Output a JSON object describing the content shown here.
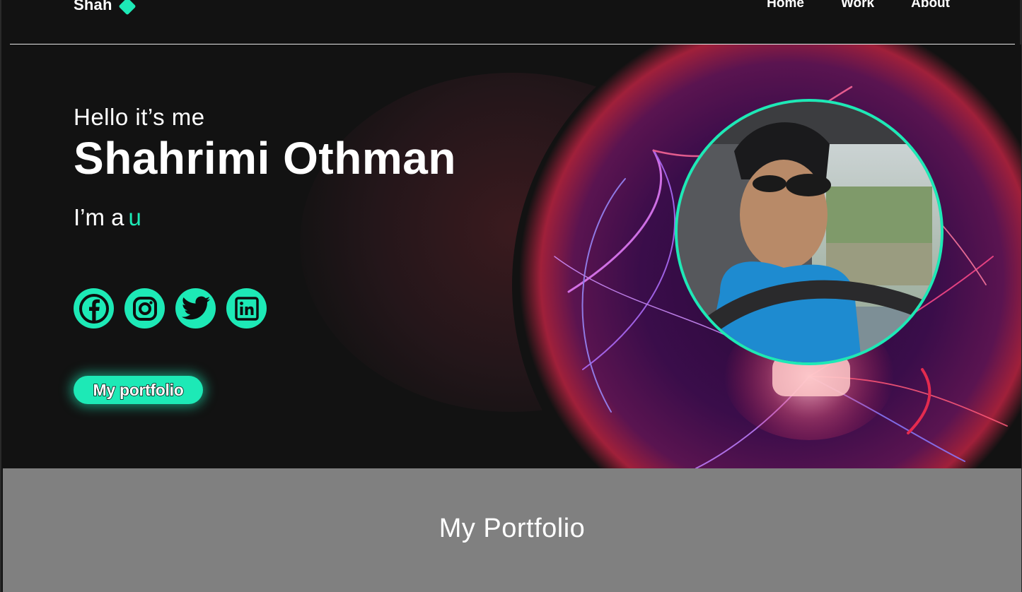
{
  "brand": {
    "name": "Shah",
    "accent_color": "#1de9b6"
  },
  "nav": {
    "links": [
      "Home",
      "Work",
      "About"
    ]
  },
  "hero": {
    "greeting": "Hello it’s me",
    "name": "Shahrimi Othman",
    "role_prefix": "I’m a",
    "role_typed": "u",
    "socials": [
      {
        "icon": "facebook-icon"
      },
      {
        "icon": "instagram-icon"
      },
      {
        "icon": "twitter-icon"
      },
      {
        "icon": "linkedin-icon"
      }
    ],
    "cta_label": "My portfolio"
  },
  "portfolio": {
    "title": "My Portfolio"
  }
}
